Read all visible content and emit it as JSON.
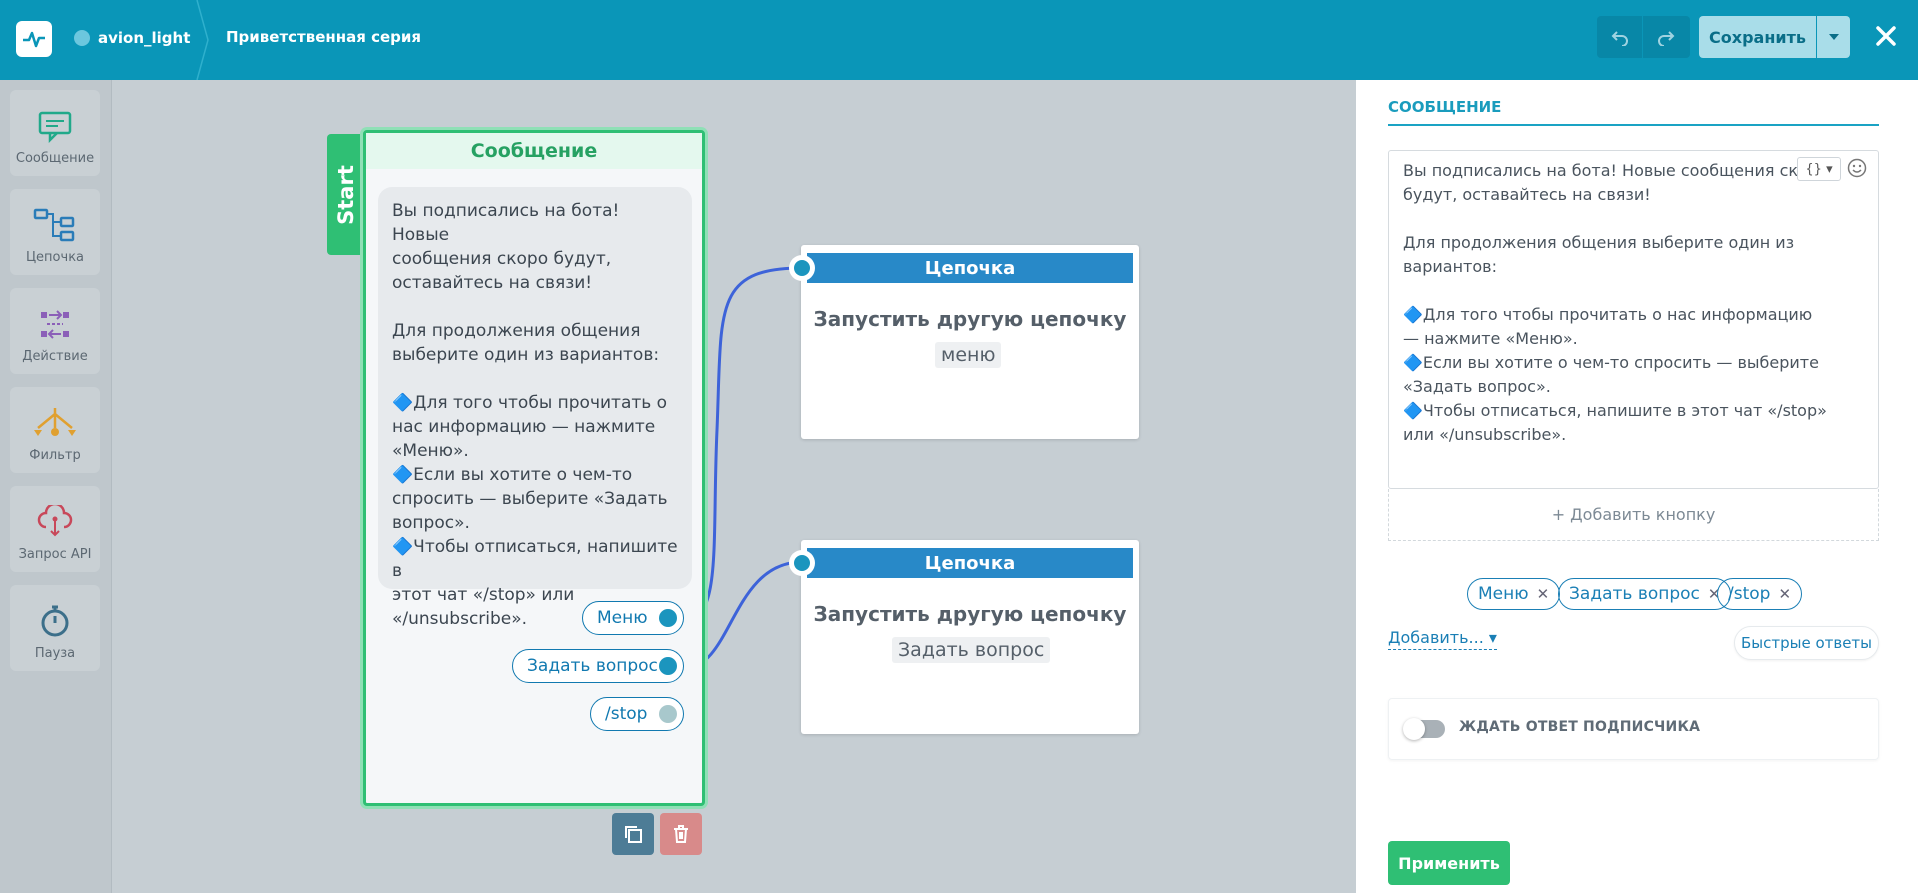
{
  "header": {
    "bot_name": "avion_light",
    "series_title": "Приветственная серия",
    "save_label": "Сохранить"
  },
  "toolbox": {
    "items": [
      {
        "label": "Сообщение",
        "icon": "message-icon"
      },
      {
        "label": "Цепочка",
        "icon": "chain-icon"
      },
      {
        "label": "Действие",
        "icon": "action-icon"
      },
      {
        "label": "Фильтр",
        "icon": "filter-icon"
      },
      {
        "label": "Запрос API",
        "icon": "api-request-icon"
      },
      {
        "label": "Пауза",
        "icon": "pause-timer-icon"
      }
    ]
  },
  "canvas": {
    "start_label": "Start",
    "message_node": {
      "title": "Сообщение",
      "text": "Вы подписались на бота! Новые\nсообщения скоро будут,\nоставайтесь на связи!\n\nДля продолжения общения\nвыберите один из вариантов:\n\n🔷Для того чтобы прочитать о\nнас информацию — нажмите\n«Меню».\n🔷Если вы хотите о чем-то\nспросить — выберите «Задать\nвопрос».\n🔷Чтобы отписаться, напишите в\nэтот чат «/stop» или\n«/unsubscribe».",
      "replies": [
        "Меню",
        "Задать вопрос",
        "/stop"
      ]
    },
    "chain_nodes": [
      {
        "title": "Цепочка",
        "text": "Запустить другую цепочку",
        "tag": "меню"
      },
      {
        "title": "Цепочка",
        "text": "Запустить другую цепочку",
        "tag": "Задать вопрос"
      }
    ]
  },
  "panel": {
    "section_title": "СООБЩЕНИЕ",
    "message_text": "Вы подписались на бота! Новые сообщения скоро\nбудут, оставайтесь на связи!\n\nДля продолжения общения выберите один из\nвариантов:\n\n🔷Для того чтобы прочитать о нас информацию\n— нажмите «Меню».\n🔷Если вы хотите о чем-то спросить — выберите\n«Задать вопрос».\n🔷Чтобы отписаться, напишите в этот чат «/stop»\nили «/unsubscribe».",
    "var_button": "{} ▾",
    "add_button_label": "+ Добавить кнопку",
    "quick_replies": [
      "Меню",
      "Задать вопрос",
      "/stop"
    ],
    "add_dropdown_label": "Добавить... ▾",
    "quick_answers_label": "Быстрые ответы",
    "wait_reply_label": "ЖДАТЬ ОТВЕТ ПОДПИСЧИКА",
    "wait_reply_enabled": false,
    "apply_label": "Применить"
  },
  "colors": {
    "header": "#0a96b8",
    "accent_green": "#2fbf74",
    "chain_blue": "#2889c8",
    "link_blue": "#1a7fb5"
  }
}
